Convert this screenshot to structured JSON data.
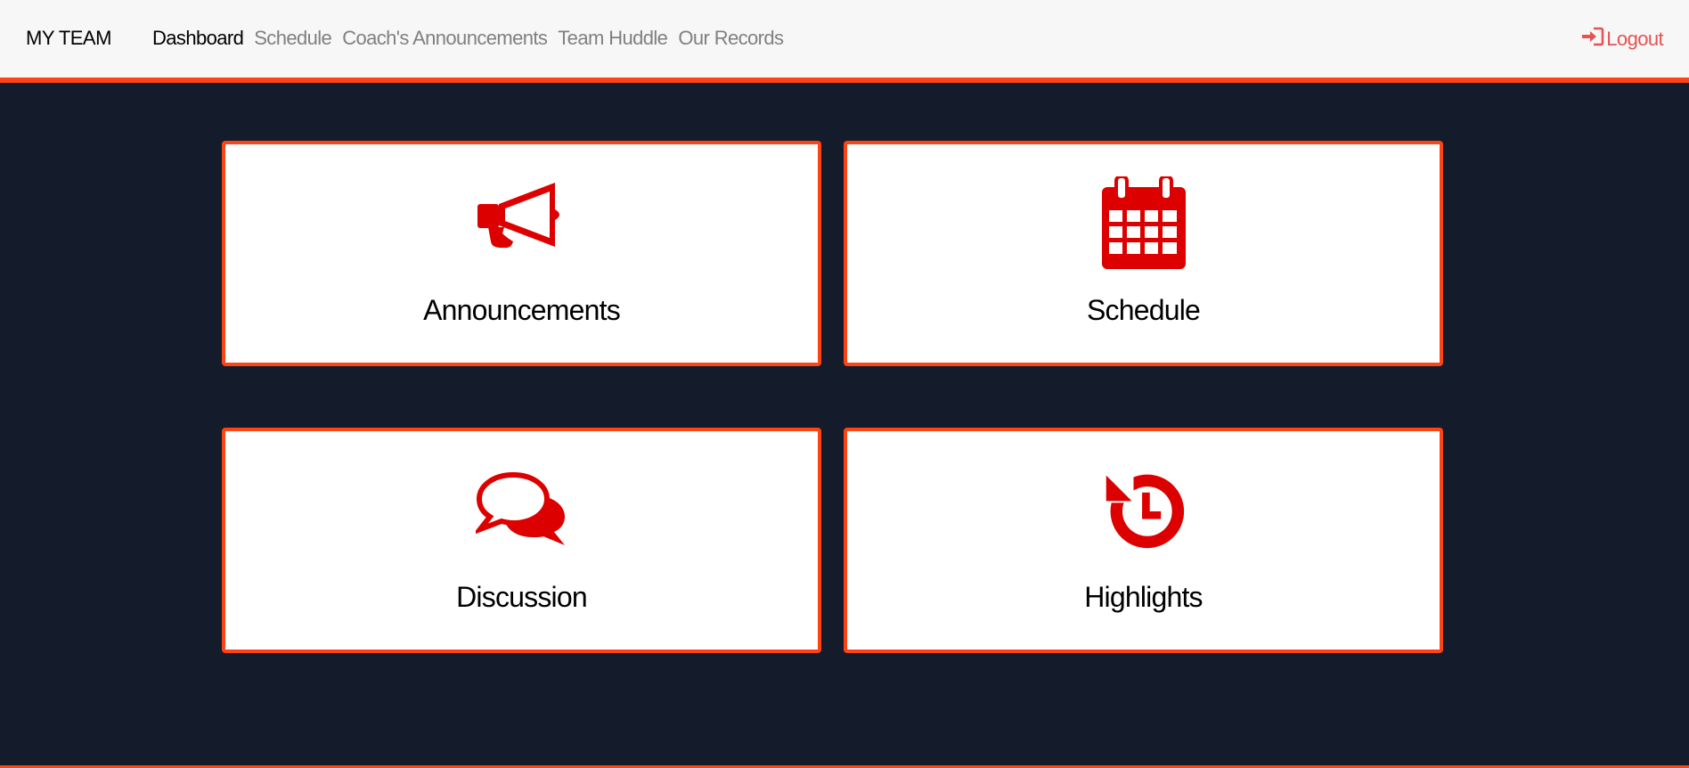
{
  "nav": {
    "brand": "MY TEAM",
    "links": [
      {
        "label": "Dashboard",
        "active": true
      },
      {
        "label": "Schedule",
        "active": false
      },
      {
        "label": "Coach's Announcements",
        "active": false
      },
      {
        "label": "Team Huddle",
        "active": false
      },
      {
        "label": "Our Records",
        "active": false
      }
    ],
    "logout_label": "Logout",
    "logout_icon": "sign-in-icon"
  },
  "cards": [
    {
      "label": "Announcements",
      "icon": "megaphone-icon"
    },
    {
      "label": "Schedule",
      "icon": "calendar-icon"
    },
    {
      "label": "Discussion",
      "icon": "chat-bubbles-icon"
    },
    {
      "label": "Highlights",
      "icon": "history-icon"
    }
  ],
  "colors": {
    "accent": "#fd4414",
    "icon_red": "#dd0000",
    "background": "#141c2b",
    "navbar_bg": "#f7f7f7",
    "logout": "#e55353"
  }
}
